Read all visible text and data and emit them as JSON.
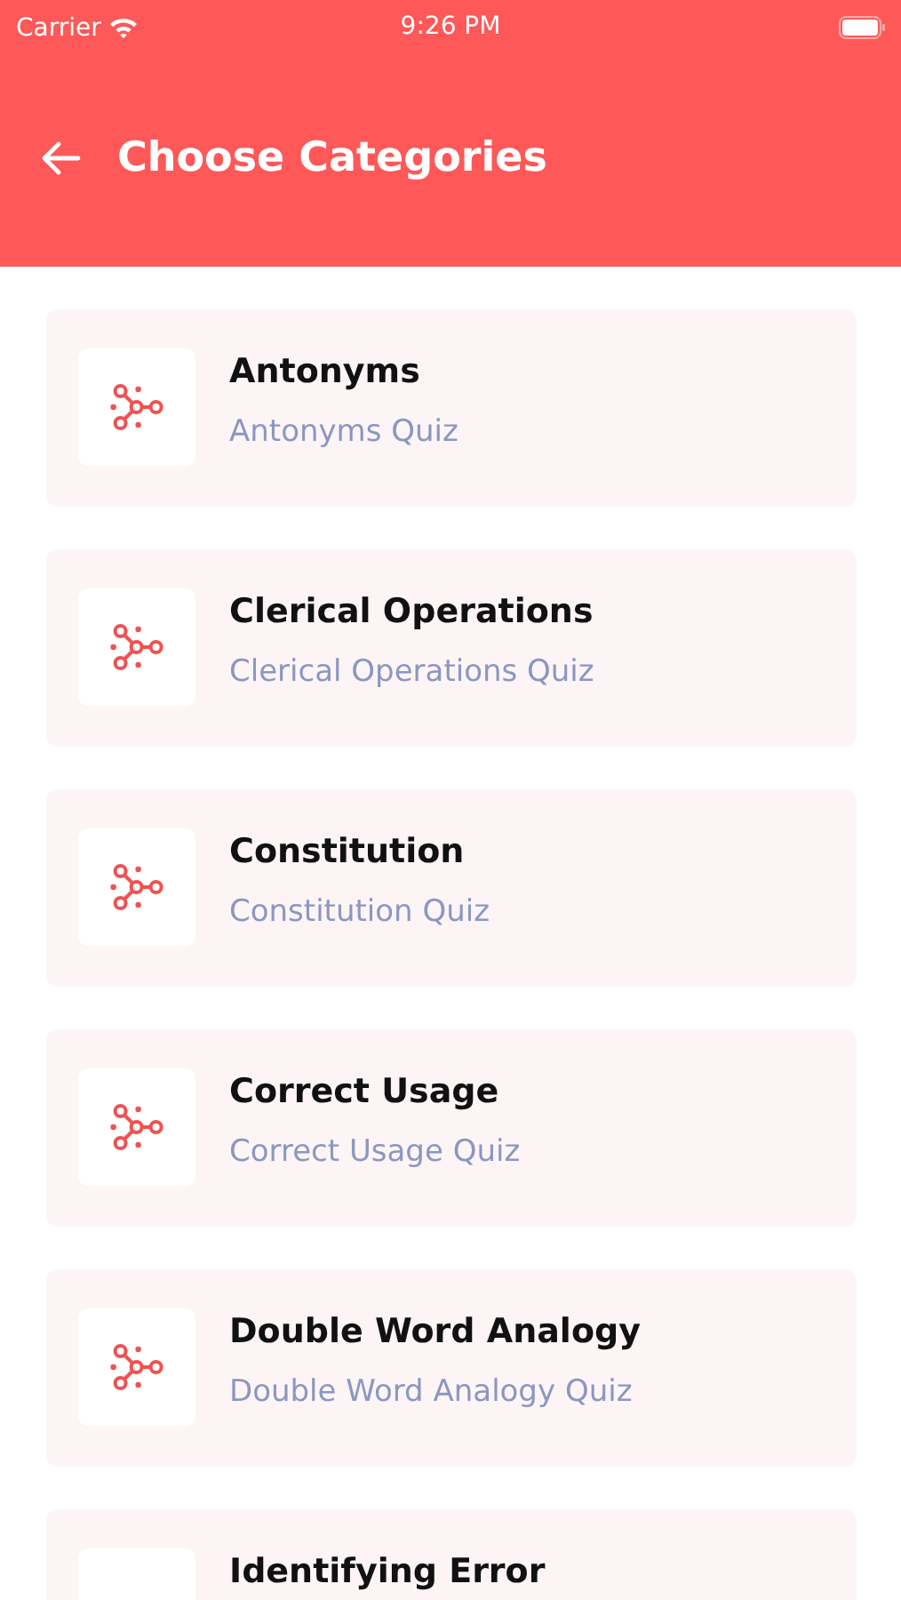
{
  "status_bar": {
    "carrier": "Carrier",
    "time": "9:26 PM"
  },
  "header": {
    "title": "Choose Categories"
  },
  "categories": [
    {
      "title": "Antonyms",
      "subtitle": "Antonyms Quiz"
    },
    {
      "title": "Clerical Operations",
      "subtitle": "Clerical Operations Quiz"
    },
    {
      "title": "Constitution",
      "subtitle": "Constitution Quiz"
    },
    {
      "title": "Correct Usage",
      "subtitle": "Correct Usage Quiz"
    },
    {
      "title": "Double Word Analogy",
      "subtitle": "Double Word Analogy Quiz"
    },
    {
      "title": "Identifying Error"
    }
  ]
}
